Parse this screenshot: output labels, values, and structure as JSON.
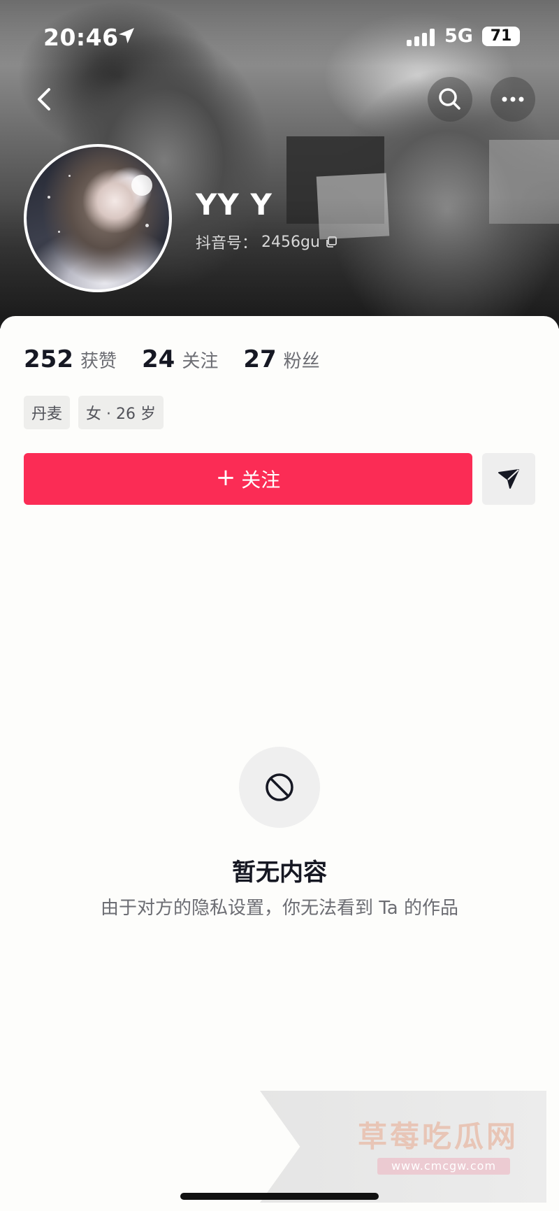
{
  "status_bar": {
    "time": "20:46",
    "network": "5G",
    "battery": "71"
  },
  "profile": {
    "username": "YY Y",
    "douyin_id_label": "抖音号：",
    "douyin_id": "2456gu",
    "stats": [
      {
        "value": "252",
        "label": "获赞"
      },
      {
        "value": "24",
        "label": "关注"
      },
      {
        "value": "27",
        "label": "粉丝"
      }
    ],
    "tags": [
      "丹麦",
      "女 · 26 岁"
    ]
  },
  "actions": {
    "follow_plus": "+",
    "follow_label": "关注"
  },
  "empty_state": {
    "title": "暂无内容",
    "description": "由于对方的隐私设置，你无法看到 Ta 的作品"
  },
  "watermark": {
    "title": "草莓吃瓜网",
    "url": "www.cmcgw.com"
  },
  "colors": {
    "accent": "#fb2c55",
    "text_primary": "#161823",
    "text_secondary": "#6c6d73"
  },
  "icons": [
    "location-arrow-icon",
    "signal-icon",
    "back-icon",
    "search-icon",
    "more-icon",
    "copy-icon",
    "send-icon",
    "forbidden-icon"
  ]
}
